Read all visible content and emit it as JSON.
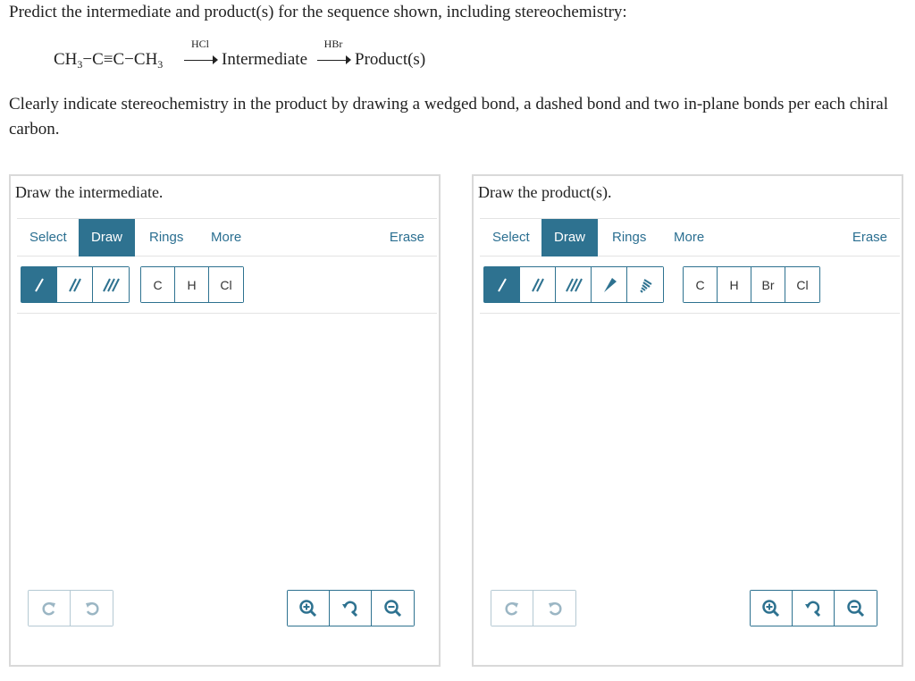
{
  "question": "Predict the intermediate and product(s) for the sequence shown, including stereochemistry:",
  "reaction": {
    "reactant_part1": "CH",
    "reactant_sub1": "3",
    "reactant_part2": "−C≡C−CH",
    "reactant_sub2": "3",
    "reagent1": "HCl",
    "intermediate": "Intermediate",
    "reagent2": "HBr",
    "product": "Product(s)"
  },
  "instruction": "Clearly indicate stereochemistry in the product by drawing a wedged bond, a dashed bond and two in-plane bonds per each chiral carbon.",
  "colors": {
    "accent": "#2e7290",
    "link": "#2b6f91",
    "border": "#d9d9d9",
    "undo_inactive": "#9bb6c4"
  },
  "panels": [
    {
      "title": "Draw the intermediate.",
      "tabs": {
        "select": "Select",
        "draw": "Draw",
        "rings": "Rings",
        "more": "More",
        "erase": "Erase"
      },
      "active_tab": "Draw",
      "bond_tools": [
        "single-bond-icon",
        "double-bond-icon",
        "triple-bond-icon"
      ],
      "atoms": [
        "C",
        "H",
        "Cl"
      ]
    },
    {
      "title": "Draw the product(s).",
      "tabs": {
        "select": "Select",
        "draw": "Draw",
        "rings": "Rings",
        "more": "More",
        "erase": "Erase"
      },
      "active_tab": "Draw",
      "bond_tools": [
        "single-bond-icon",
        "double-bond-icon",
        "triple-bond-icon",
        "wedge-bond-icon",
        "dash-bond-icon"
      ],
      "atoms": [
        "C",
        "H",
        "Br",
        "Cl"
      ]
    }
  ]
}
